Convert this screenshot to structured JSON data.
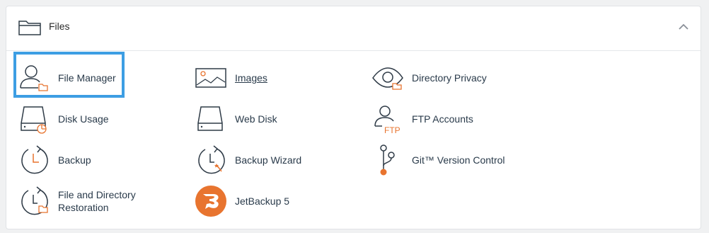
{
  "section": {
    "title": "Files",
    "icon": "folder-icon",
    "collapse_icon": "chevron-up-icon"
  },
  "colors": {
    "accent_orange": "#e8742f",
    "icon_stroke": "#2f3b47",
    "link_text": "#293a4a",
    "selection_border": "#3d9ee3"
  },
  "items": [
    {
      "label": "File Manager",
      "icon": "file-manager-icon",
      "selected": true
    },
    {
      "label": "Images",
      "icon": "images-icon",
      "link": true
    },
    {
      "label": "Directory Privacy",
      "icon": "directory-privacy-icon"
    },
    {
      "label": "Disk Usage",
      "icon": "disk-usage-icon"
    },
    {
      "label": "Web Disk",
      "icon": "web-disk-icon"
    },
    {
      "label": "FTP Accounts",
      "icon": "ftp-accounts-icon",
      "icon_text": "FTP"
    },
    {
      "label": "Backup",
      "icon": "backup-icon"
    },
    {
      "label": "Backup Wizard",
      "icon": "backup-wizard-icon"
    },
    {
      "label": "Git™ Version Control",
      "icon": "git-version-control-icon"
    },
    {
      "label_line1": "File and Directory",
      "label_line2": "Restoration",
      "icon": "file-restoration-icon"
    },
    {
      "label": "JetBackup 5",
      "icon": "jetbackup-icon"
    }
  ]
}
